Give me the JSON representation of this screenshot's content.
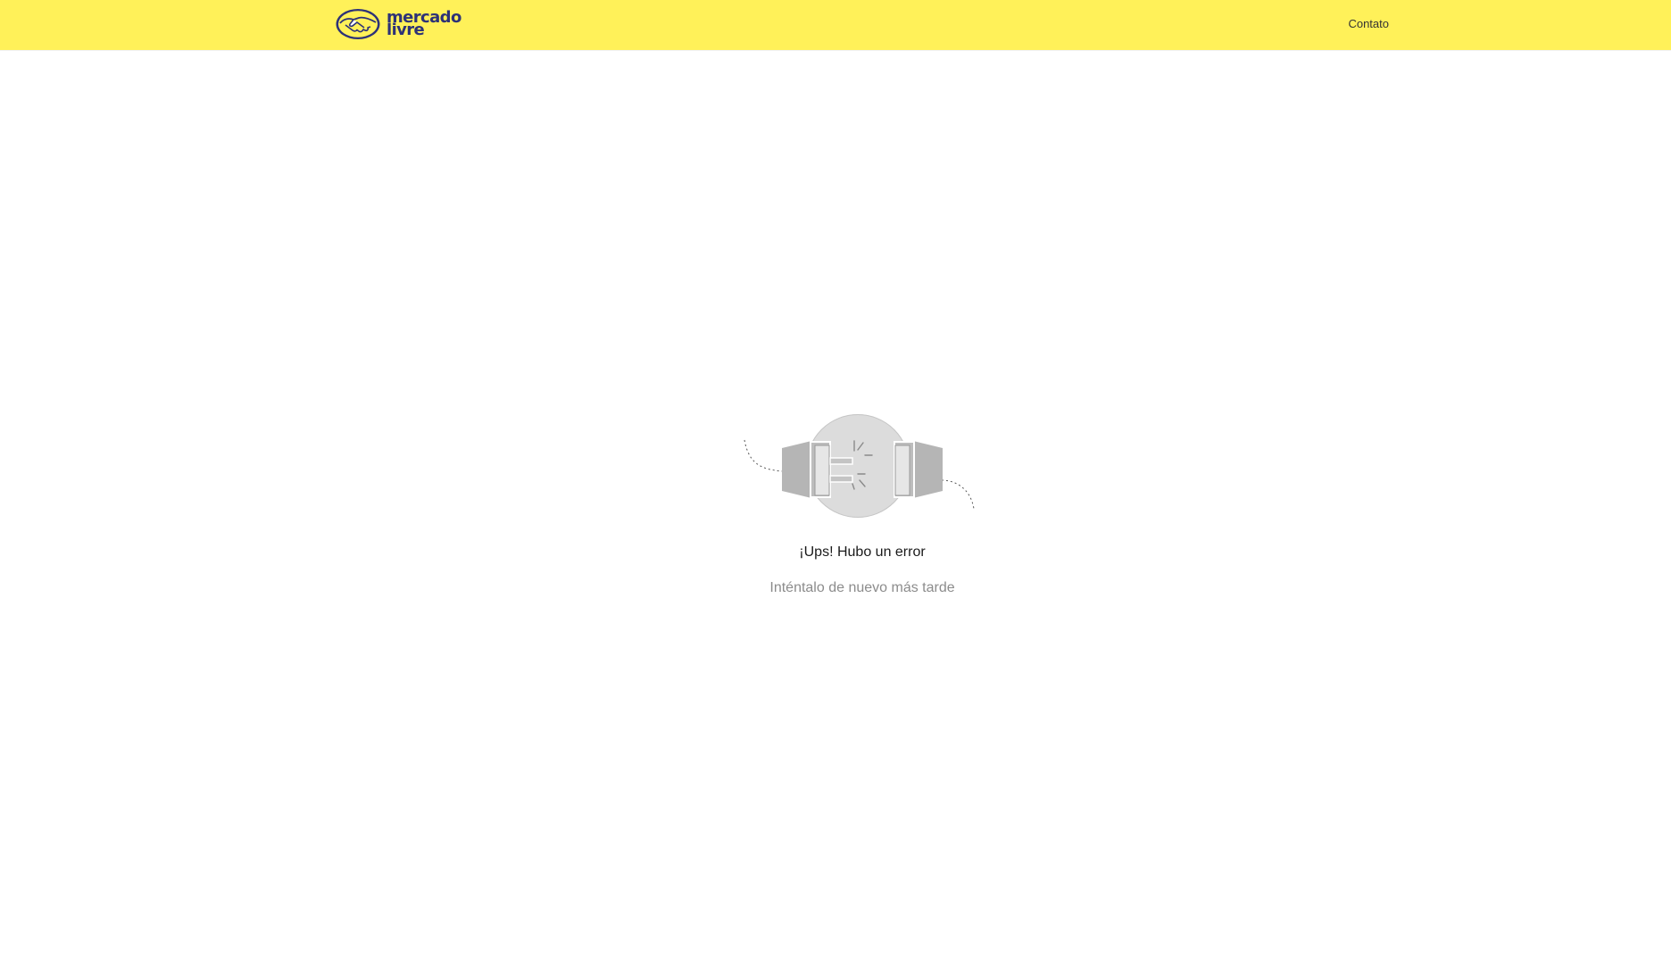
{
  "header": {
    "logo": {
      "icon": "handshake-logo-icon",
      "line1": "mercado",
      "line2": "livre"
    },
    "contact_label": "Contato"
  },
  "error": {
    "illustration_icon": "unplugged-connection-icon",
    "title": "¡Ups! Hubo un error",
    "subtitle": "Inténtalo de nuevo más tarde"
  },
  "colors": {
    "header_bg": "#fff159",
    "brand_navy": "#2d3277",
    "illustration_gray": "#bdbdbd"
  }
}
